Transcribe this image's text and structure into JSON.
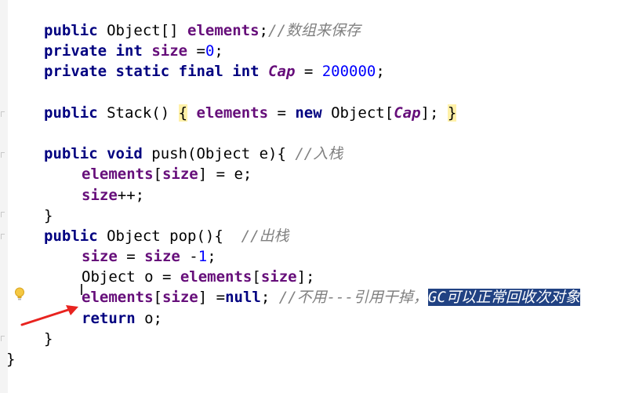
{
  "editor": {
    "lines": [
      {
        "indent": "i4",
        "tokens": [
          {
            "t": "public",
            "c": "kw"
          },
          {
            "t": " Object[] ",
            "c": ""
          },
          {
            "t": "elements",
            "c": "field"
          },
          {
            "t": ";",
            "c": ""
          },
          {
            "t": "//数组来保存",
            "c": "cmt"
          }
        ]
      },
      {
        "indent": "i4",
        "tokens": [
          {
            "t": "private",
            "c": "kw"
          },
          {
            "t": " ",
            "c": ""
          },
          {
            "t": "int",
            "c": "kw"
          },
          {
            "t": " ",
            "c": ""
          },
          {
            "t": "size",
            "c": "field"
          },
          {
            "t": " =",
            "c": ""
          },
          {
            "t": "0",
            "c": "num"
          },
          {
            "t": ";",
            "c": ""
          }
        ]
      },
      {
        "indent": "i4",
        "tokens": [
          {
            "t": "private",
            "c": "kw"
          },
          {
            "t": " ",
            "c": ""
          },
          {
            "t": "static",
            "c": "kw"
          },
          {
            "t": " ",
            "c": ""
          },
          {
            "t": "final",
            "c": "kw"
          },
          {
            "t": " ",
            "c": ""
          },
          {
            "t": "int",
            "c": "kw"
          },
          {
            "t": " ",
            "c": ""
          },
          {
            "t": "Cap",
            "c": "stat"
          },
          {
            "t": " = ",
            "c": ""
          },
          {
            "t": "200000",
            "c": "num"
          },
          {
            "t": ";",
            "c": ""
          }
        ]
      },
      {
        "indent": "i4",
        "tokens": []
      },
      {
        "indent": "i4",
        "tokens": [
          {
            "t": "public",
            "c": "kw"
          },
          {
            "t": " Stack() ",
            "c": ""
          },
          {
            "t": "{",
            "c": "brace-hl"
          },
          {
            "t": " ",
            "c": ""
          },
          {
            "t": "elements",
            "c": "field"
          },
          {
            "t": " = ",
            "c": ""
          },
          {
            "t": "new",
            "c": "kw"
          },
          {
            "t": " Object[",
            "c": ""
          },
          {
            "t": "Cap",
            "c": "stat"
          },
          {
            "t": "]; ",
            "c": ""
          },
          {
            "t": "}",
            "c": "brace-hl"
          }
        ]
      },
      {
        "indent": "i4",
        "tokens": []
      },
      {
        "indent": "i4",
        "tokens": [
          {
            "t": "public",
            "c": "kw"
          },
          {
            "t": " ",
            "c": ""
          },
          {
            "t": "void",
            "c": "kw"
          },
          {
            "t": " push(Object e){ ",
            "c": ""
          },
          {
            "t": "//入栈",
            "c": "cmt"
          }
        ]
      },
      {
        "indent": "i8",
        "tokens": [
          {
            "t": "elements",
            "c": "field"
          },
          {
            "t": "[",
            "c": ""
          },
          {
            "t": "size",
            "c": "field"
          },
          {
            "t": "] = e;",
            "c": ""
          }
        ]
      },
      {
        "indent": "i8",
        "tokens": [
          {
            "t": "size",
            "c": "field"
          },
          {
            "t": "++;",
            "c": ""
          }
        ]
      },
      {
        "indent": "i4",
        "tokens": [
          {
            "t": "}",
            "c": ""
          }
        ]
      },
      {
        "indent": "i4",
        "tokens": [
          {
            "t": "public",
            "c": "kw"
          },
          {
            "t": " Object pop(){  ",
            "c": ""
          },
          {
            "t": "//出栈",
            "c": "cmt"
          }
        ]
      },
      {
        "indent": "i8",
        "tokens": [
          {
            "t": "size",
            "c": "field"
          },
          {
            "t": " = ",
            "c": ""
          },
          {
            "t": "size",
            "c": "field"
          },
          {
            "t": " -",
            "c": ""
          },
          {
            "t": "1",
            "c": "num"
          },
          {
            "t": ";",
            "c": ""
          }
        ]
      },
      {
        "indent": "i8",
        "tokens": [
          {
            "t": "Object o = ",
            "c": ""
          },
          {
            "t": "elements",
            "c": "field"
          },
          {
            "t": "[",
            "c": ""
          },
          {
            "t": "size",
            "c": "field"
          },
          {
            "t": "];",
            "c": ""
          }
        ]
      },
      {
        "indent": "i8",
        "tokens": [
          {
            "t": "elements",
            "c": "field"
          },
          {
            "t": "[",
            "c": ""
          },
          {
            "t": "size",
            "c": "field"
          },
          {
            "t": "] =",
            "c": ""
          },
          {
            "t": "null",
            "c": "kw"
          },
          {
            "t": "; ",
            "c": ""
          },
          {
            "t": "//不用---引用干掉，",
            "c": "cmt"
          },
          {
            "t": "GC可以正常回收次对象",
            "c": "sel"
          }
        ]
      },
      {
        "indent": "i8",
        "tokens": [
          {
            "t": "return",
            "c": "kw"
          },
          {
            "t": " o;",
            "c": ""
          }
        ]
      },
      {
        "indent": "i4",
        "tokens": [
          {
            "t": "}",
            "c": ""
          }
        ]
      },
      {
        "indent": "i0",
        "tokens": [
          {
            "t": "}",
            "c": ""
          }
        ]
      }
    ]
  },
  "icons": {
    "bulb": "lightbulb-icon",
    "arrow": "red-arrow-annotation"
  },
  "colors": {
    "keyword": "#000080",
    "field": "#660e7a",
    "number": "#0000ff",
    "comment": "#808080",
    "selection": "#214283",
    "arrow": "#e8231f",
    "bulb": "#f5c842"
  }
}
